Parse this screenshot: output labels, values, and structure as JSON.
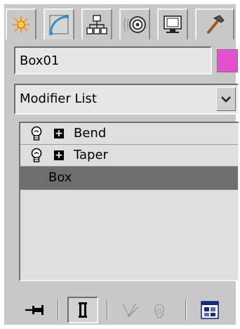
{
  "tabs": [
    {
      "name": "create-tab",
      "icon": "star-burst-icon"
    },
    {
      "name": "modify-tab",
      "icon": "curve-modify-icon",
      "active": true
    },
    {
      "name": "hierarchy-tab",
      "icon": "hierarchy-icon"
    },
    {
      "name": "motion-tab",
      "icon": "motion-target-icon"
    },
    {
      "name": "display-tab",
      "icon": "monitor-icon"
    },
    {
      "name": "utilities-tab",
      "icon": "hammer-icon"
    }
  ],
  "object": {
    "name": "Box01",
    "color": "#e34fcf"
  },
  "modifier_list": {
    "label": "Modifier List"
  },
  "stack": {
    "items": [
      {
        "label": "Bend"
      },
      {
        "label": "Taper"
      },
      {
        "label": "Box",
        "selected": true
      }
    ]
  },
  "colors": {
    "panel": "#c8c8c8",
    "selection": "#6e6e6e"
  }
}
